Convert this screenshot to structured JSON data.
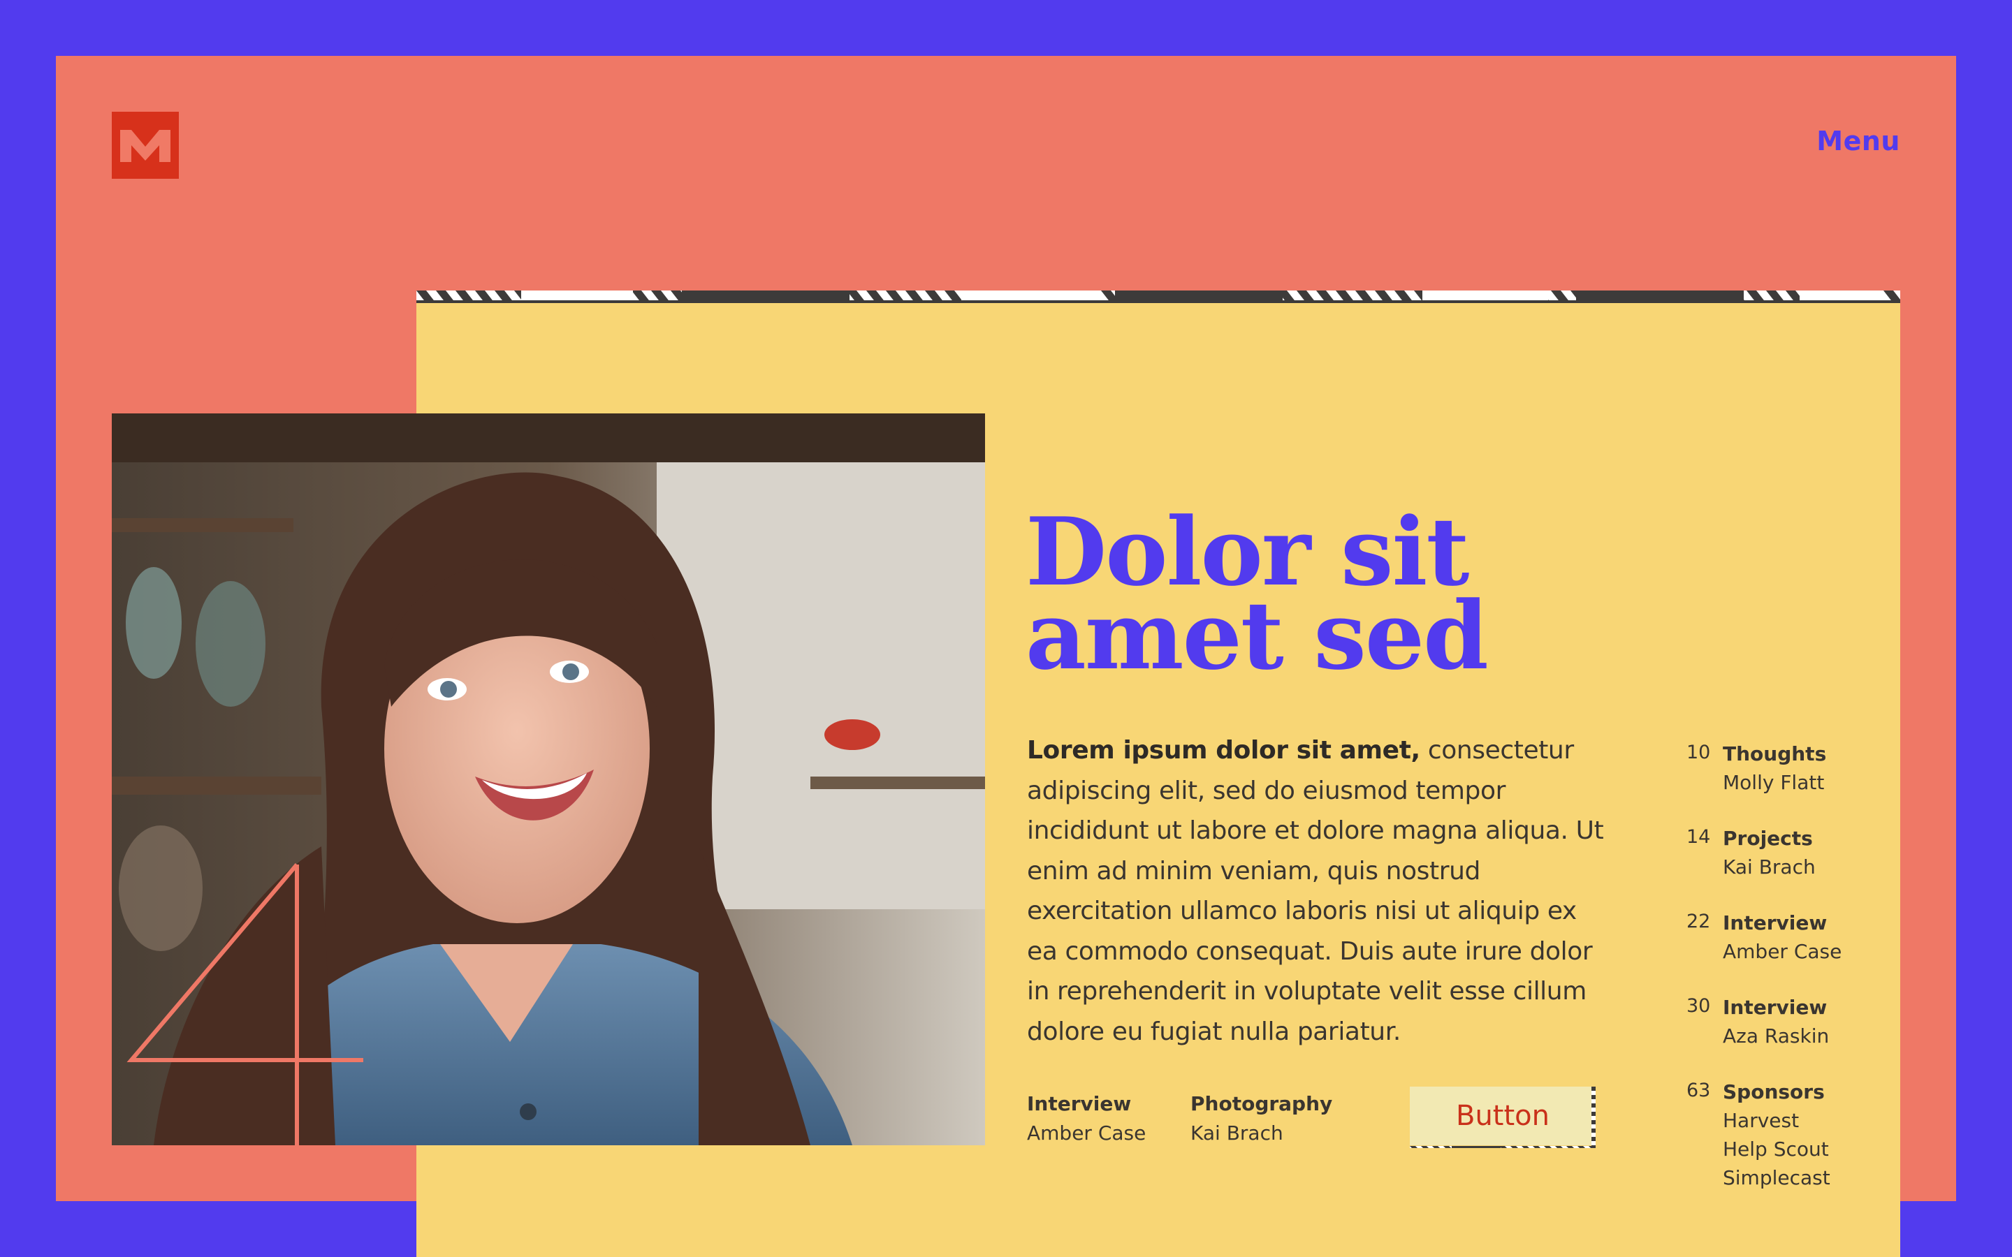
{
  "header": {
    "logo_letter": "M",
    "menu_label": "Menu"
  },
  "feature": {
    "number": "4",
    "headline_line1": "Dolor sit",
    "headline_line2": "amet sed",
    "lead_bold": "Lorem ipsum dolor sit amet,",
    "lead_rest": " consectetur adipiscing elit, sed do eiusmod tempor incididunt ut labore et dolore magna aliqua. Ut enim ad minim veniam, quis nostrud exercitation ullamco laboris nisi ut aliquip ex ea commodo consequat. Duis aute irure dolor in reprehenderit in voluptate velit esse cillum dolore eu fugiat nulla pariatur.",
    "credits": [
      {
        "role": "Interview",
        "person": "Amber Case"
      },
      {
        "role": "Photography",
        "person": "Kai Brach"
      }
    ],
    "button_label": "Button"
  },
  "toc": [
    {
      "num": "10",
      "title": "Thoughts",
      "subs": [
        "Molly Flatt"
      ]
    },
    {
      "num": "14",
      "title": "Projects",
      "subs": [
        "Kai Brach"
      ]
    },
    {
      "num": "22",
      "title": "Interview",
      "subs": [
        "Amber Case"
      ]
    },
    {
      "num": "30",
      "title": "Interview",
      "subs": [
        "Aza Raskin"
      ]
    },
    {
      "num": "63",
      "title": "Sponsors",
      "subs": [
        "Harvest",
        "Help Scout",
        "Simplecast"
      ]
    }
  ],
  "colors": {
    "background": "#523BEE",
    "coral": "#EF7866",
    "yellow": "#F8D675",
    "logo": "#D7311B",
    "accent_purple": "#523BEE",
    "button_text": "#C9311A"
  }
}
